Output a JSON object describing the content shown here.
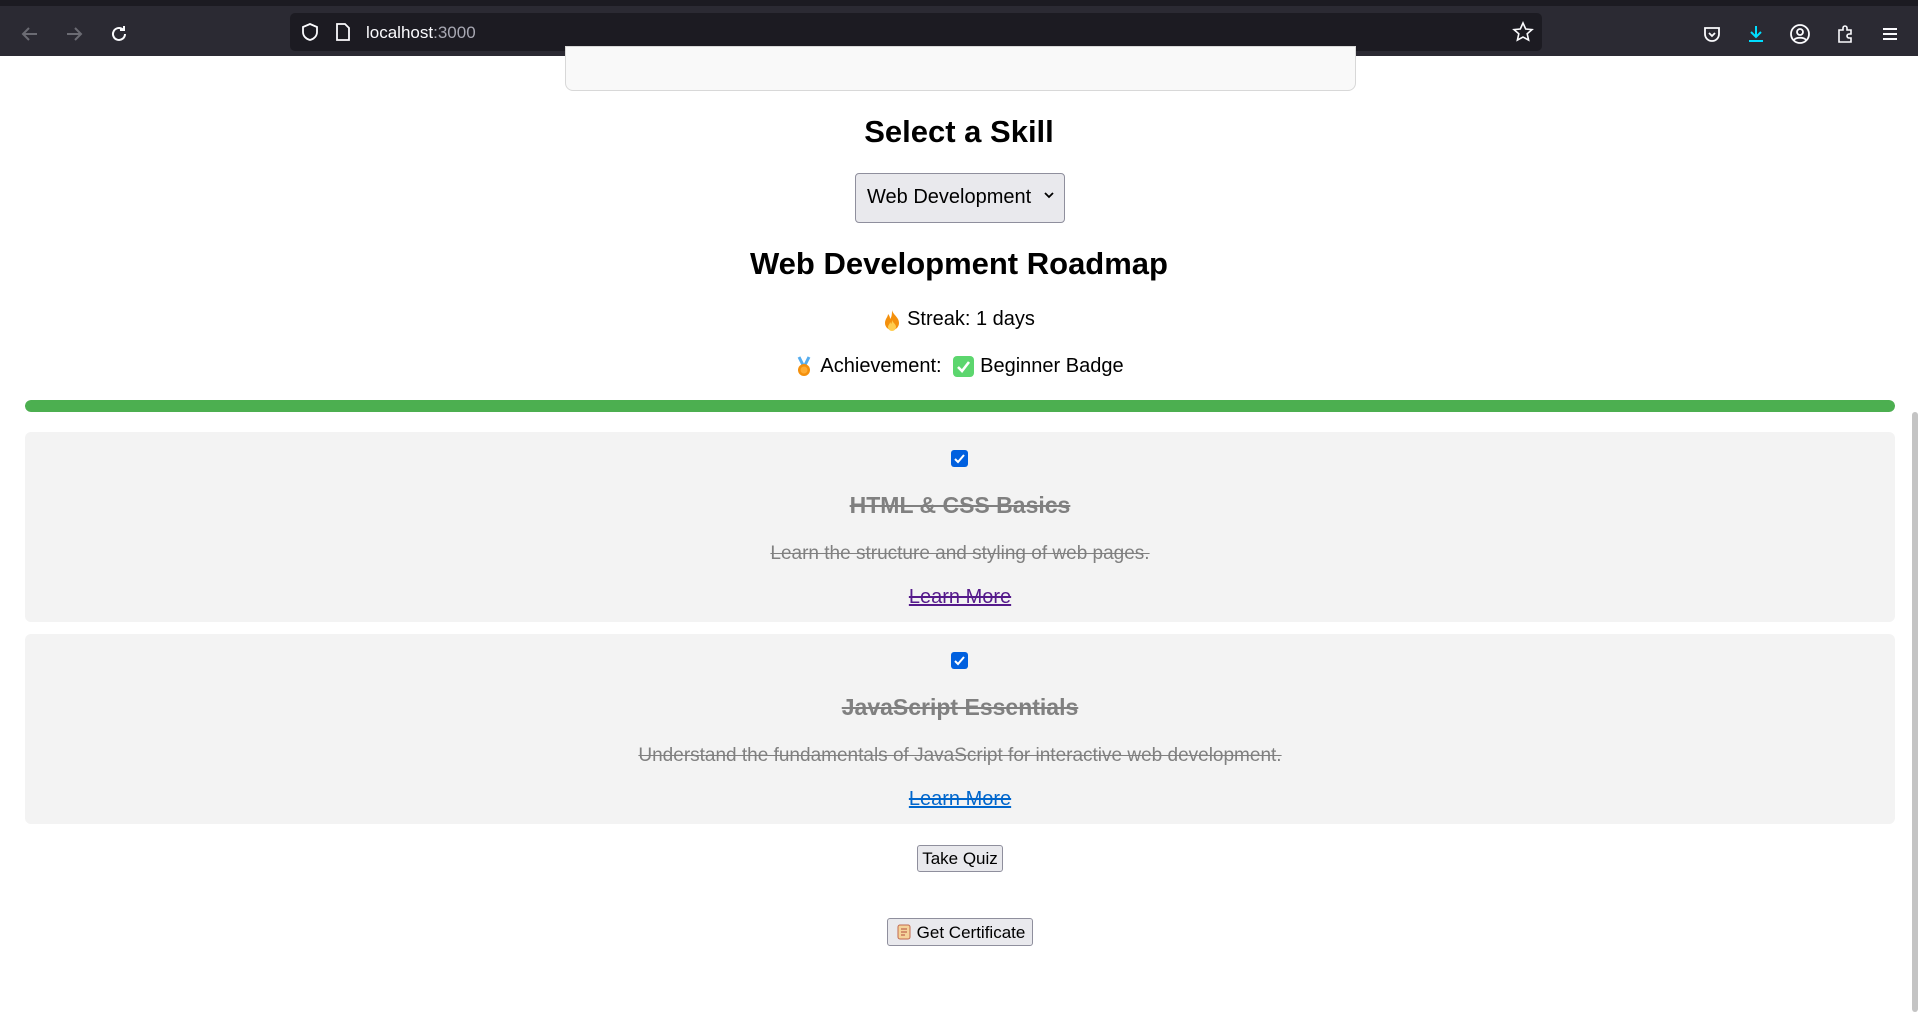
{
  "browser": {
    "url_host": "localhost",
    "url_port": ":3000"
  },
  "main": {
    "select_heading": "Select a Skill",
    "selected_skill": "Web Development",
    "roadmap_title": "Web Development Roadmap",
    "streak_text": "Streak: 1 days",
    "achievement_label": "Achievement:",
    "achievement_value": "Beginner Badge",
    "progress_percent": 100,
    "progress_color": "#4caf50"
  },
  "topics": [
    {
      "title": "HTML & CSS Basics",
      "description": "Learn the structure and styling of web pages.",
      "link": "Learn More",
      "completed": true
    },
    {
      "title": "JavaScript Essentials",
      "description": "Understand the fundamentals of JavaScript for interactive web development.",
      "link": "Learn More",
      "completed": true
    }
  ],
  "buttons": {
    "quiz": "Take Quiz",
    "certificate": "Get Certificate"
  },
  "icons": {
    "streak": "fire-icon",
    "achievement": "medal-icon",
    "badge": "check-mark-icon",
    "certificate": "scroll-icon"
  }
}
